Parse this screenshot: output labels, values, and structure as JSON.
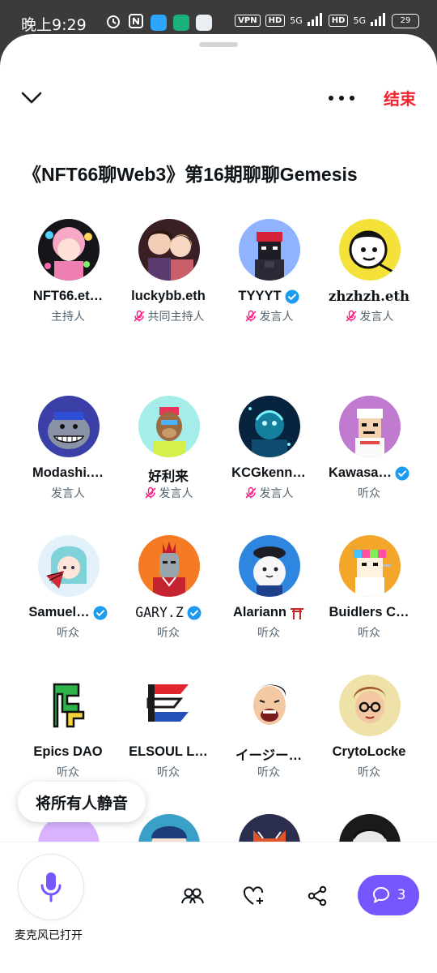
{
  "status_bar": {
    "time": "晚上9:29",
    "vpn": "VPN",
    "hd1": "HD",
    "net1": "5G",
    "hd2": "HD",
    "net2": "5G",
    "battery": "29"
  },
  "header": {
    "end_label": "结束"
  },
  "space": {
    "title": "《NFT66聊Web3》第16期聊聊Gemesis"
  },
  "participants": [
    {
      "name": "NFT66.et…",
      "role": "主持人",
      "muted": false,
      "verified": false,
      "avatar": "pink-hair-girl-avatar"
    },
    {
      "name": "luckybb.eth",
      "role": "共同主持人",
      "muted": true,
      "verified": false,
      "avatar": "two-girls-avatar"
    },
    {
      "name": "TYYYT",
      "role": "发言人",
      "muted": true,
      "verified": true,
      "avatar": "pixel-ninja-avatar"
    },
    {
      "name": "zhzhzh.eth",
      "role": "发言人",
      "muted": true,
      "verified": false,
      "avatar": "cartoon-face-avatar"
    },
    {
      "name": "Modashi.…",
      "role": "发言人",
      "muted": false,
      "verified": false,
      "avatar": "grinning-shark-avatar"
    },
    {
      "name": "好利来",
      "role": "发言人",
      "muted": true,
      "verified": false,
      "avatar": "ape-avatar"
    },
    {
      "name": "KCGkenn…",
      "role": "发言人",
      "muted": true,
      "verified": false,
      "avatar": "glowing-dragon-avatar"
    },
    {
      "name": "Kawasa…",
      "role": "听众",
      "muted": false,
      "verified": true,
      "avatar": "pixel-punk-avatar"
    },
    {
      "name": "Samuel…",
      "role": "听众",
      "muted": false,
      "verified": true,
      "avatar": "anime-girl-fan-avatar"
    },
    {
      "name": "GARY.Z",
      "role": "听众",
      "muted": false,
      "verified": true,
      "avatar": "robot-punk-avatar"
    },
    {
      "name": "Alariann",
      "role": "听众",
      "muted": false,
      "verified": false,
      "avatar": "seal-beret-avatar",
      "suffix_icon": "torii-gate-icon"
    },
    {
      "name": "Buidlers C…",
      "role": "听众",
      "muted": false,
      "verified": false,
      "avatar": "rainbow-pixel-punk-avatar"
    },
    {
      "name": "Epics DAO",
      "role": "听众",
      "muted": false,
      "verified": false,
      "avatar": "epics-logo-avatar"
    },
    {
      "name": "ELSOUL L…",
      "role": "听众",
      "muted": false,
      "verified": false,
      "avatar": "elsoul-logo-avatar"
    },
    {
      "name": "イージー…",
      "role": "听众",
      "muted": false,
      "verified": false,
      "avatar": "laughing-man-avatar"
    },
    {
      "name": "CrytoLocke",
      "role": "听众",
      "muted": false,
      "verified": false,
      "avatar": "glasses-boy-avatar"
    },
    {
      "name": "",
      "role": "",
      "muted": false,
      "verified": false,
      "avatar": "purple-character-avatar"
    },
    {
      "name": "",
      "role": "",
      "muted": false,
      "verified": false,
      "avatar": "anime-illustration-avatar"
    },
    {
      "name": "",
      "role": "",
      "muted": false,
      "verified": false,
      "avatar": "red-panda-hoodie-avatar"
    },
    {
      "name": "",
      "role": "",
      "muted": false,
      "verified": false,
      "avatar": "sketch-character-avatar"
    }
  ],
  "mute_all_label": "将所有人静音",
  "bottom_bar": {
    "mic_label": "麦克风已打开",
    "chat_count": "3"
  },
  "colors": {
    "accent_purple": "#7856ff",
    "end_red": "#f4212e",
    "verified_blue": "#1d9bf0",
    "mute_pink": "#f91880"
  }
}
